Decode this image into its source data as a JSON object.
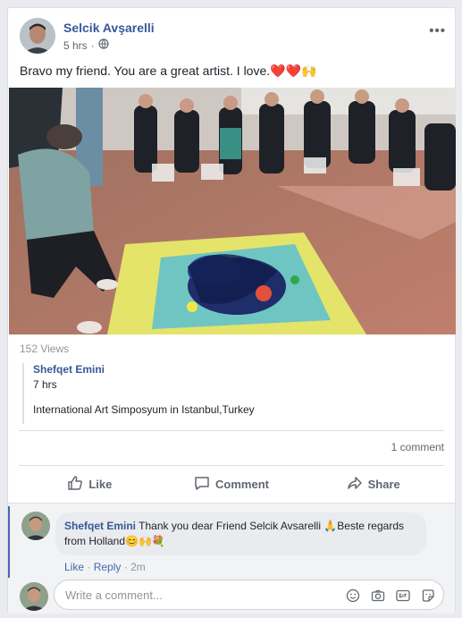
{
  "post": {
    "author": "Selcik Avşarelli",
    "time": "5 hrs",
    "separator": "·",
    "message": "Bravo my friend. You are a great artist. I love.",
    "message_emoji": "❤️❤️🙌"
  },
  "video": {
    "views": "152 Views"
  },
  "shared": {
    "author": "Shefqet Emini",
    "time": "7 hrs",
    "text": "International Art Simposyum in Istanbul,Turkey"
  },
  "stats": {
    "comments": "1 comment"
  },
  "actions": {
    "like": "Like",
    "comment": "Comment",
    "share": "Share"
  },
  "comment": {
    "author": "Shefqet Emini",
    "text": "Thank you dear Friend Selcik Avsarelli 🙏Beste regards from Holland😊🙌💐",
    "like": "Like",
    "reply": "Reply",
    "dot": "·",
    "time": "2m"
  },
  "write": {
    "placeholder": "Write a comment..."
  },
  "colors": {
    "link": "#385898",
    "accent": "#4267b2",
    "muted": "#606770"
  }
}
